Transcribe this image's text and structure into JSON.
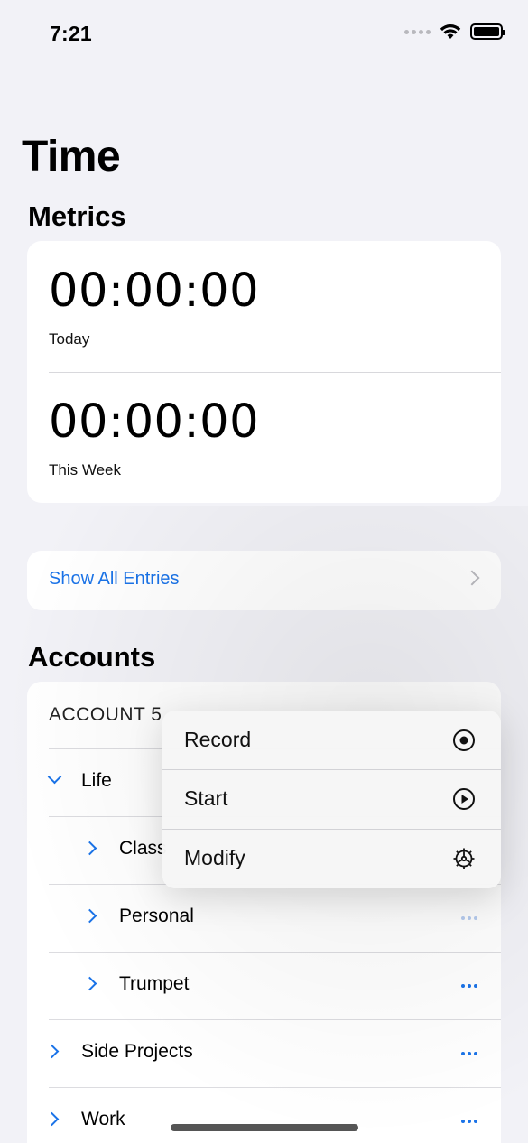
{
  "status_bar": {
    "time": "7:21"
  },
  "title": "Time",
  "metrics": {
    "section_title": "Metrics",
    "items": [
      {
        "value": "00:00:00",
        "label": "Today"
      },
      {
        "value": "00:00:00",
        "label": "This Week"
      }
    ]
  },
  "entries_link": "Show All Entries",
  "accounts": {
    "section_title": "Accounts",
    "account_header": "ACCOUNT 5",
    "rows": [
      {
        "label": "Life",
        "expanded": true,
        "level": 0
      },
      {
        "label": "Class",
        "level": 1
      },
      {
        "label": "Personal",
        "level": 1
      },
      {
        "label": "Trumpet",
        "level": 1
      },
      {
        "label": "Side Projects",
        "level": 0
      },
      {
        "label": "Work",
        "level": 0
      }
    ]
  },
  "context_menu": {
    "items": [
      {
        "label": "Record",
        "icon": "record-circle-icon"
      },
      {
        "label": "Start",
        "icon": "play-circle-icon"
      },
      {
        "label": "Modify",
        "icon": "gear-icon"
      }
    ]
  },
  "colors": {
    "accent": "#1a73e8",
    "background": "#f2f2f7"
  }
}
